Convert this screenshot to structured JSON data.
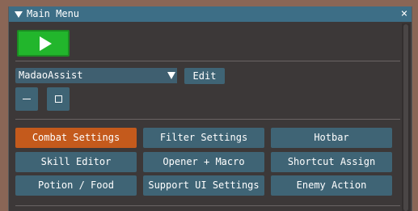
{
  "window": {
    "title": "Main Menu",
    "close_glyph": "×",
    "collapse_icon": "triangle-down-icon"
  },
  "play": {
    "icon": "play-icon",
    "color": "#22b62c"
  },
  "preset": {
    "selected": "MadaoAssist",
    "edit_label": "Edit"
  },
  "window_controls": {
    "minimize_icon": "minimize-icon",
    "window_icon": "window-icon"
  },
  "menu": {
    "accent_active": "#c45a1c",
    "button_color": "#3f6475",
    "buttons": [
      {
        "label": "Combat Settings",
        "active": true
      },
      {
        "label": "Filter Settings",
        "active": false
      },
      {
        "label": "Hotbar",
        "active": false
      },
      {
        "label": "Skill Editor",
        "active": false
      },
      {
        "label": "Opener + Macro",
        "active": false
      },
      {
        "label": "Shortcut Assign",
        "active": false
      },
      {
        "label": "Potion / Food",
        "active": false
      },
      {
        "label": "Support UI Settings",
        "active": false
      },
      {
        "label": "Enemy Action",
        "active": false
      }
    ]
  }
}
